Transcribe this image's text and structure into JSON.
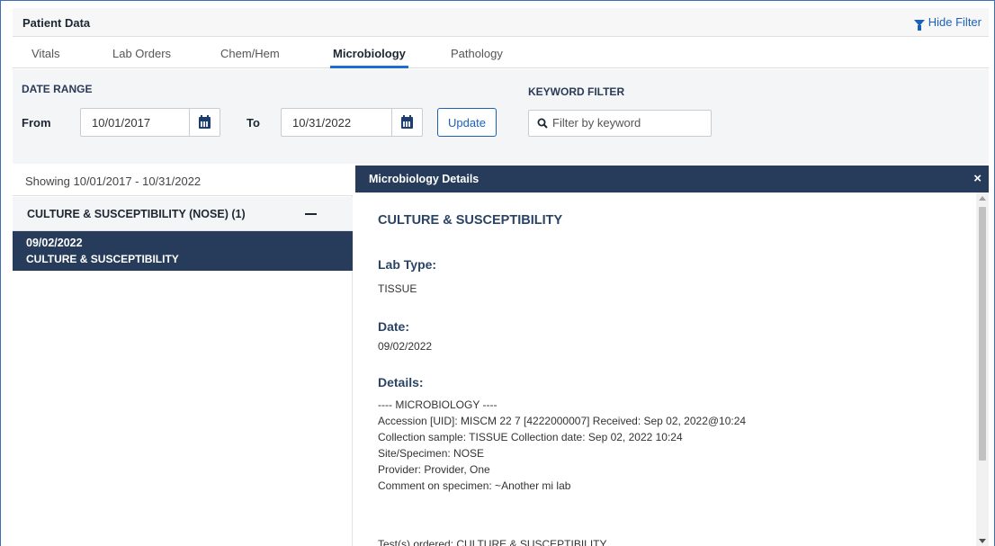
{
  "header": {
    "title": "Patient Data",
    "hide_filter_label": "Hide Filter"
  },
  "tabs": [
    {
      "label": "Vitals"
    },
    {
      "label": "Lab Orders"
    },
    {
      "label": "Chem/Hem"
    },
    {
      "label": "Microbiology",
      "active": true
    },
    {
      "label": "Pathology"
    }
  ],
  "filter": {
    "date_range_label": "DATE RANGE",
    "from_label": "From",
    "from_value": "10/01/2017",
    "to_label": "To",
    "to_value": "10/31/2022",
    "update_label": "Update",
    "keyword_label": "KEYWORD FILTER",
    "keyword_placeholder": "Filter by keyword",
    "keyword_value": ""
  },
  "list": {
    "showing": "Showing 10/01/2017 - 10/31/2022",
    "groups": [
      {
        "title": "CULTURE & SUSCEPTIBILITY (NOSE) (1)",
        "entries": [
          {
            "date": "09/02/2022",
            "name": "CULTURE & SUSCEPTIBILITY",
            "selected": true
          }
        ]
      }
    ]
  },
  "detail": {
    "header_title": "Microbiology Details",
    "close_label": "×",
    "title": "CULTURE & SUSCEPTIBILITY",
    "lab_type_label": "Lab Type:",
    "lab_type_value": "TISSUE",
    "date_label": "Date:",
    "date_value": "09/02/2022",
    "details_label": "Details:",
    "details_lines": [
      "---- MICROBIOLOGY ----",
      "Accession [UID]: MISCM 22 7 [4222000007] Received: Sep 02, 2022@10:24",
      "Collection sample: TISSUE Collection date: Sep 02, 2022 10:24",
      "Site/Specimen: NOSE",
      "Provider: Provider, One",
      "Comment on specimen: ~Another mi lab"
    ],
    "tests_ordered_line": "Test(s) ordered: CULTURE & SUSCEPTIBILITY"
  },
  "colors": {
    "navy": "#263c5a",
    "link_blue": "#1a62b8",
    "tab_underline": "#1c6fd1"
  },
  "icons": [
    "funnel-icon",
    "calendar-icon",
    "search-icon",
    "minus-icon",
    "close-icon"
  ]
}
